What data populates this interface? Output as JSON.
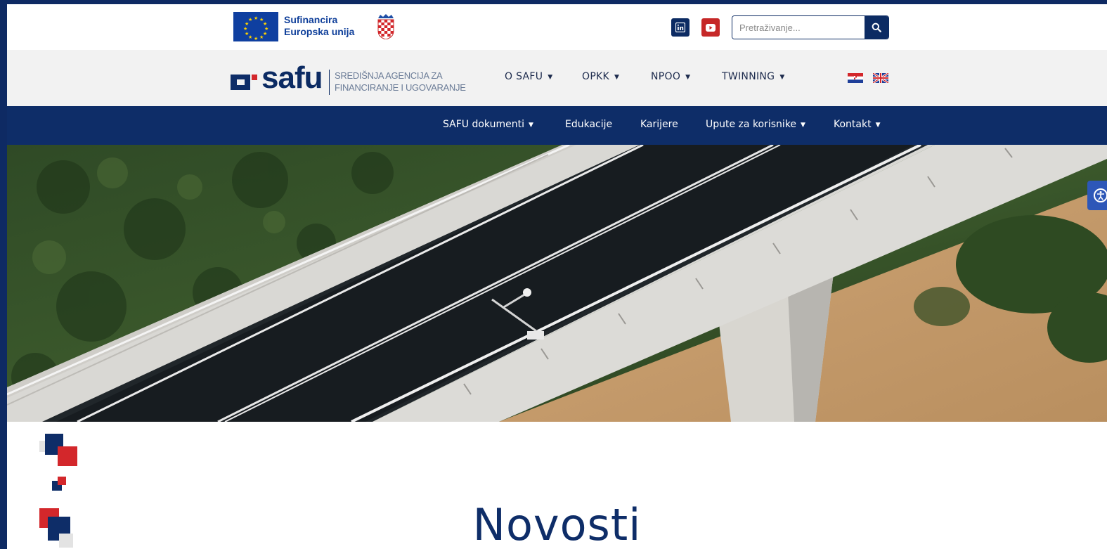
{
  "cofunding": {
    "line1": "Sufinancira",
    "line2": "Europska unija"
  },
  "icons": {
    "eu_flag": "eu-flag-icon",
    "coat_of_arms": "croatian-coat-of-arms-icon",
    "linkedin": "linkedin-icon",
    "youtube": "youtube-icon",
    "search": "search-icon",
    "accessibility": "accessibility-icon",
    "flag_hr": "croatian-flag-icon",
    "flag_en": "uk-flag-icon"
  },
  "search": {
    "placeholder": "Pretraživanje..."
  },
  "logo": {
    "word": "safu",
    "subtitle_line1": "SREDIŠNJA AGENCIJA ZA",
    "subtitle_line2": "FINANCIRANJE I UGOVARANJE"
  },
  "main_nav": [
    {
      "label": "O SAFU"
    },
    {
      "label": "OPKK"
    },
    {
      "label": "NPOO"
    },
    {
      "label": "TWINNING"
    }
  ],
  "sub_nav": [
    {
      "label": "SAFU dokumenti",
      "dropdown": true
    },
    {
      "label": "Edukacije",
      "dropdown": false
    },
    {
      "label": "Karijere",
      "dropdown": false
    },
    {
      "label": "Upute za korisnike",
      "dropdown": true
    },
    {
      "label": "Kontakt",
      "dropdown": true
    }
  ],
  "section": {
    "title": "Novosti"
  },
  "colors": {
    "navy": "#0e2d68",
    "red": "#d3272b",
    "light_gray": "#f2f2f2"
  }
}
